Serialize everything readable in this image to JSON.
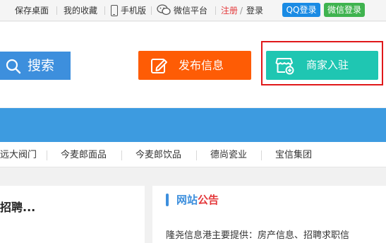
{
  "topbar": {
    "save_desktop": "保存桌面",
    "favorites": "我的收藏",
    "mobile": "手机版",
    "wechat_platform": "微信平台",
    "register": "注册",
    "slash": "/",
    "login": "登录",
    "qq_login": "QQ登录",
    "wechat_login": "微信登录"
  },
  "header": {
    "search_label": "搜索",
    "publish_label": "发布信息",
    "merchant_label": "商家入驻"
  },
  "links": [
    "远大阀门",
    "今麦郎面品",
    "今麦郎饮品",
    "德尚瓷业",
    "宝信集团"
  ],
  "left_panel": {
    "title": "招聘..."
  },
  "right_panel": {
    "title_part1": "网站",
    "title_part2": "公告",
    "desc": "隆尧信息港主要提供：房产信息、招聘求职信"
  },
  "colors": {
    "search": "#3d8fdd",
    "publish": "#fe5c05",
    "merchant": "#1fc6b2",
    "highlight": "#e0181a",
    "nav": "#3d9be0",
    "qq": "#1a8be4",
    "wechat": "#3fb34f"
  }
}
